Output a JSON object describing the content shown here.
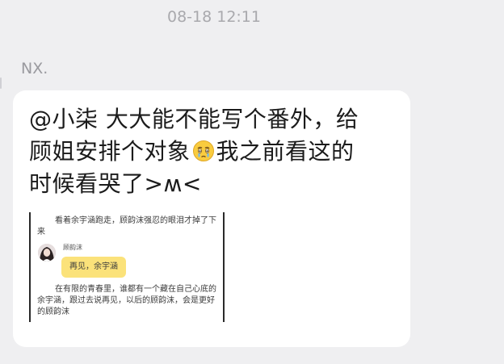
{
  "timestamp": "08-18 12:11",
  "sender": "NX.",
  "message": {
    "line1": "@小柒 大大能不能写个番外，给",
    "line2_a": "顾姐安排个对象",
    "line2_emoji": "crying-face-icon",
    "line2_b": "我之前看这的",
    "line3": "时候看哭了>ʍ<"
  },
  "quote_image": {
    "para1": "看着余宇涵跑走，顾韵沫强忍的眼泪才掉了下来",
    "speaker_name": "顾韵沫",
    "speech": "再见，余宇涵",
    "para2": "在有限的青春里，谁都有一个藏在自己心底的余宇涵，跟过去说再见，以后的顾韵沫，会是更好的顾韵沫"
  },
  "colors": {
    "background": "#efeff1",
    "bubble": "#ffffff",
    "speech_bubble": "#fbe27a"
  }
}
